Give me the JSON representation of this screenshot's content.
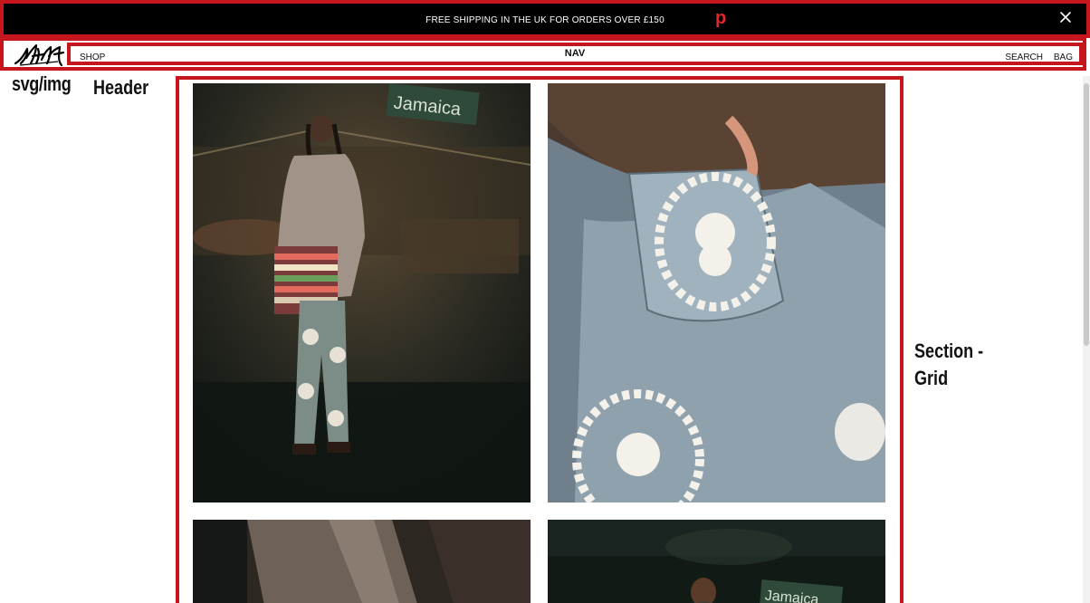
{
  "announcement": {
    "text": "FREE SHIPPING IN THE UK FOR ORDERS OVER £150",
    "annotation": "p",
    "close_icon": "close-icon"
  },
  "header": {
    "logo_icon": "stussy-logo",
    "nav": {
      "label": "NAV",
      "shop": "SHOP",
      "search": "SEARCH",
      "bag": "BAG"
    }
  },
  "annotations": {
    "logo": "svg/img",
    "header": "Header",
    "section": "Section -",
    "section_sub": "Grid"
  },
  "grid": {
    "tiles": [
      {
        "subject": "model-in-cardigan-street-sign-jamaica",
        "sign": "Jamaica"
      },
      {
        "subject": "denim-jeans-with-stock-logo-patches"
      },
      {
        "subject": "knit-cardigan-detail"
      },
      {
        "subject": "model-street-sign-jamaica",
        "sign": "Jamaica"
      }
    ]
  },
  "colors": {
    "annotation_red": "#c4161c",
    "announcement_bg": "#000000"
  }
}
